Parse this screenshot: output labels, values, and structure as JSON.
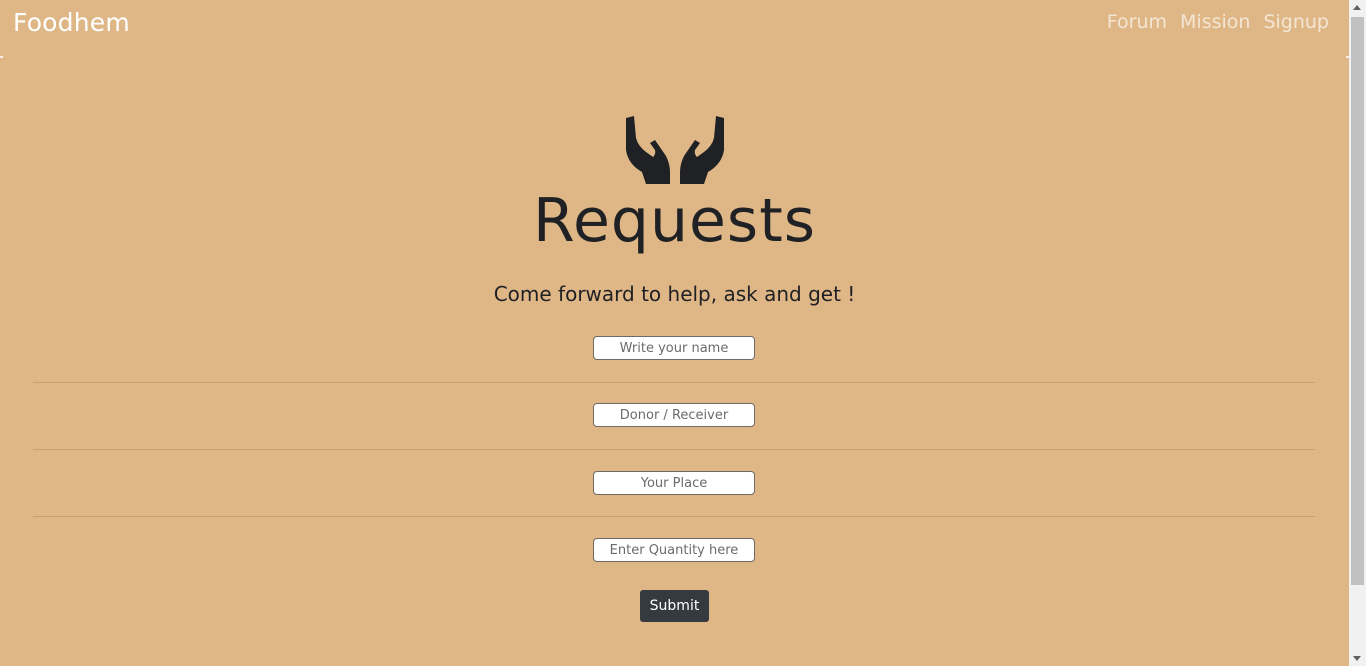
{
  "navbar": {
    "brand": "Foodhem",
    "links": [
      {
        "label": "Forum"
      },
      {
        "label": "Mission"
      },
      {
        "label": "Signup"
      }
    ]
  },
  "hero": {
    "icon": "hands-icon",
    "title": "Requests",
    "subtitle": "Come forward to help, ask and get !"
  },
  "form": {
    "fields": [
      {
        "placeholder": "Write your name",
        "value": ""
      },
      {
        "placeholder": "Donor / Receiver",
        "value": ""
      },
      {
        "placeholder": "Your Place",
        "value": ""
      },
      {
        "placeholder": "Enter Quantity here",
        "value": ""
      }
    ],
    "submit_label": "Submit"
  },
  "colors": {
    "background": "#dfb787",
    "button": "#343a40",
    "text": "#202124"
  }
}
